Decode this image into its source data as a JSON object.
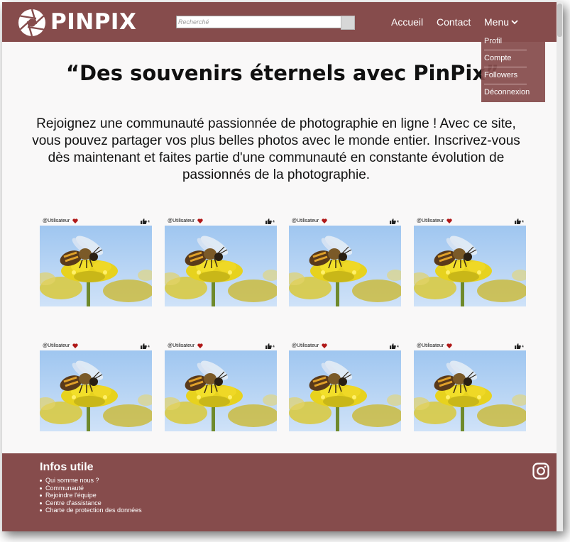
{
  "header": {
    "brand": "PINPIX",
    "search": {
      "placeholder": "Recherché"
    },
    "nav": {
      "home": "Accueil",
      "contact": "Contact",
      "menu": "Menu"
    },
    "dropdown": [
      "Profil",
      "Compte",
      "Followers",
      "Déconnexion"
    ]
  },
  "hero": {
    "title": "“Des souvenirs éternels avec PinPix”",
    "text": "Rejoignez une communauté passionnée de photographie en ligne ! Avec ce site, vous pouvez partager vos plus belles photos avec le monde entier. Inscrivez-vous dès maintenant et faites partie d'une communauté en constante évolution de passionnés de la photographie."
  },
  "gallery": {
    "cards": [
      {
        "user": "@Utilisateur",
        "likes": "4"
      },
      {
        "user": "@Utilisateur",
        "likes": "4"
      },
      {
        "user": "@Utilisateur",
        "likes": "4"
      },
      {
        "user": "@Utilisateur",
        "likes": "4"
      },
      {
        "user": "@Utilisateur",
        "likes": "4"
      },
      {
        "user": "@Utilisateur",
        "likes": "4"
      },
      {
        "user": "@Utilisateur",
        "likes": "4"
      },
      {
        "user": "@Utilisateur",
        "likes": "4"
      }
    ]
  },
  "footer": {
    "title": "Infos utile",
    "links": [
      "Qui somme nous ?",
      "Communauté",
      "Rejoindre l'équipe",
      "Centre d'assistance",
      "Charte de protection des données"
    ]
  },
  "colors": {
    "brand": "#864c4c",
    "background": "#f9f8f8",
    "heart": "#b01818"
  },
  "icons": [
    "aperture-logo-icon",
    "chevron-down-icon",
    "heart-icon",
    "thumbs-up-icon",
    "instagram-icon"
  ]
}
